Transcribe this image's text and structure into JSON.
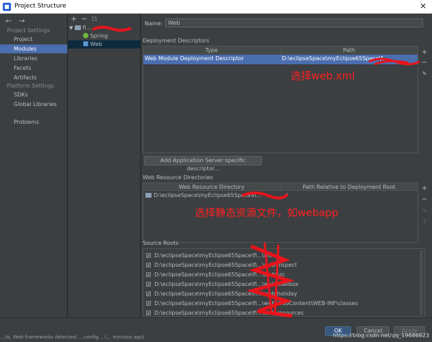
{
  "window": {
    "title": "Project Structure"
  },
  "leftnav": {
    "project_settings_header": "Project Settings",
    "project_settings_items": [
      "Project",
      "Modules",
      "Libraries",
      "Facets",
      "Artifacts"
    ],
    "platform_settings_header": "Platform Settings",
    "platform_settings_items": [
      "SDKs",
      "Global Libraries"
    ],
    "problems": "Problems",
    "selected": "Modules"
  },
  "tree": {
    "toolbar": {
      "add": "+",
      "remove": "−",
      "copy": "⧉"
    },
    "root_label": "fi...",
    "children": [
      "Spring",
      "Web"
    ],
    "selected": "Web"
  },
  "form": {
    "name_label": "Name:",
    "name_value": "Web"
  },
  "descriptors": {
    "section_title": "Deployment Descriptors",
    "col_type": "Type",
    "col_path": "Path",
    "rows": [
      {
        "type": "Web Module Deployment Descriptor",
        "path": "D:\\eclipseSpace\\myEclipse65Space\\f..."
      }
    ],
    "annotation": "选择web.xml",
    "add_app_server_button": "Add Application Server specific descriptor..."
  },
  "web_resources": {
    "section_title": "Web Resource Directories",
    "col_dir": "Web Resource Directory",
    "col_rel": "Path Relative to Deployment Root",
    "rows": [
      {
        "dir": "D:\\eclipseSpace\\myEclipse65Space\\fi...",
        "rel": "/"
      }
    ],
    "annotation": "选择静态资源文件，如webapp"
  },
  "source_roots": {
    "section_title": "Source Roots",
    "items": [
      "D:\\eclipseSpace\\myEclipse65Space\\fi...\\src",
      "D:\\eclipseSpace\\myEclipse65Space\\fi...\\web\\inspect",
      "D:\\eclipseSpace\\myEclipse65Space\\fi...\\web\\src",
      "D:\\eclipseSpace\\myEclipse65Space\\fi...\\web\\mailbox",
      "D:\\eclipseSpace\\myEclipse65Space\\fi...\\web\\holiday",
      "D:\\eclipseSpace\\myEclipse65Space\\fi...\\web\\WebContent\\WEB-INF\\classes",
      "D:\\eclipseSpace\\myEclipse65Space\\fi...\\web\\resources"
    ]
  },
  "footer": {
    "ok": "OK",
    "cancel": "Cancel",
    "apply": "Apply",
    "cut_text": "…ils, Web frameworks detected, ...config... (... minutes ago)",
    "watermark": "https://blog.csdn.net/qq_19686623"
  },
  "colors": {
    "accent_selected": "#4b6eaf",
    "background": "#3c3f41",
    "annotation": "#ff2020",
    "redaction": "#e8141c"
  },
  "icons": [
    "app-icon",
    "back-arrow-icon",
    "forward-arrow-icon",
    "add-icon",
    "remove-icon",
    "copy-icon",
    "folder-icon",
    "spring-icon",
    "web-icon",
    "edit-icon",
    "close-icon"
  ]
}
